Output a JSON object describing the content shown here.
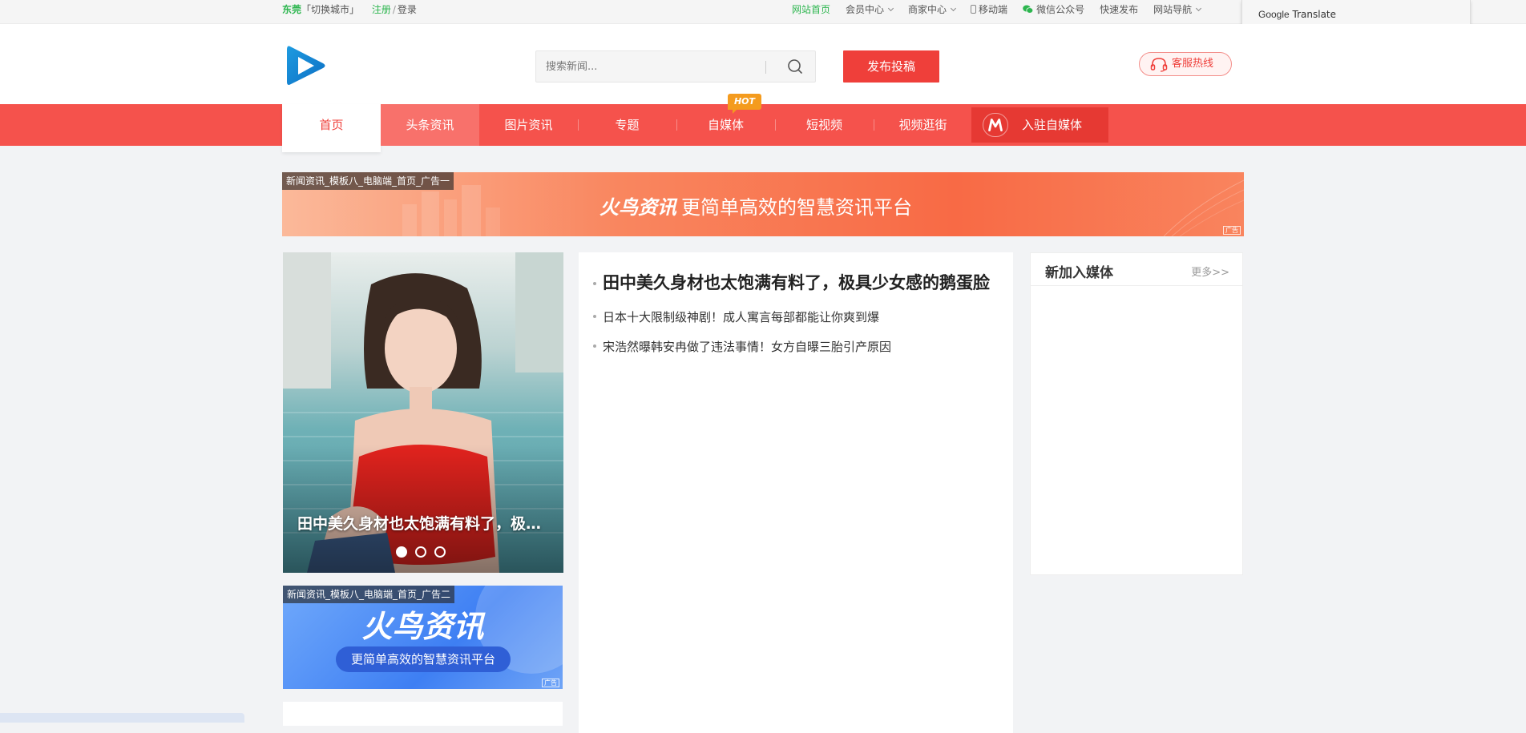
{
  "topbar": {
    "city": "东莞",
    "switch_city": "「切换城市」",
    "register": "注册",
    "separator": "/",
    "login": "登录",
    "links": {
      "home": "网站首页",
      "member": "会员中心",
      "merchant": "商家中心",
      "mobile": "移动端",
      "wechat": "微信公众号",
      "quick_publish": "快速发布",
      "site_nav": "网站导航"
    }
  },
  "google_translate": {
    "google": "Google",
    "translate": "Translate"
  },
  "header": {
    "search_placeholder": "搜索新闻...",
    "publish_button": "发布投稿",
    "hotline": "客服热线"
  },
  "nav": {
    "items": [
      "首页",
      "头条资讯",
      "图片资讯",
      "专题",
      "自媒体",
      "短视频",
      "视频逛街"
    ],
    "hot_badge": "HOT",
    "media_join": "入驻自媒体"
  },
  "ad1": {
    "tag": "新闻资讯_模板八_电脑端_首页_广告一",
    "brand": "火鸟资讯",
    "slogan": "更简单高效的智慧资讯平台",
    "mark": "广告"
  },
  "slider": {
    "caption": "田中美久身材也太饱满有料了，极具少女感的鹅蛋脸",
    "dots": 3,
    "active_dot": 1
  },
  "ad2": {
    "tag": "新闻资讯_模板八_电脑端_首页_广告二",
    "brand": "火鸟资讯",
    "slogan": "更简单高效的智慧资讯平台",
    "mark": "广告"
  },
  "news": {
    "headline": "田中美久身材也太饱满有料了，极具少女感的鹅蛋脸",
    "items": [
      "日本十大限制级神剧！成人寓言每部都能让你爽到爆",
      "宋浩然曝韩安冉做了违法事情！女方自曝三胎引产原因"
    ]
  },
  "sidebar": {
    "title": "新加入媒体",
    "more": "更多>>"
  },
  "colors": {
    "brand_red": "#ef3f3a",
    "nav_red": "#f5524c",
    "green": "#2db64f"
  }
}
